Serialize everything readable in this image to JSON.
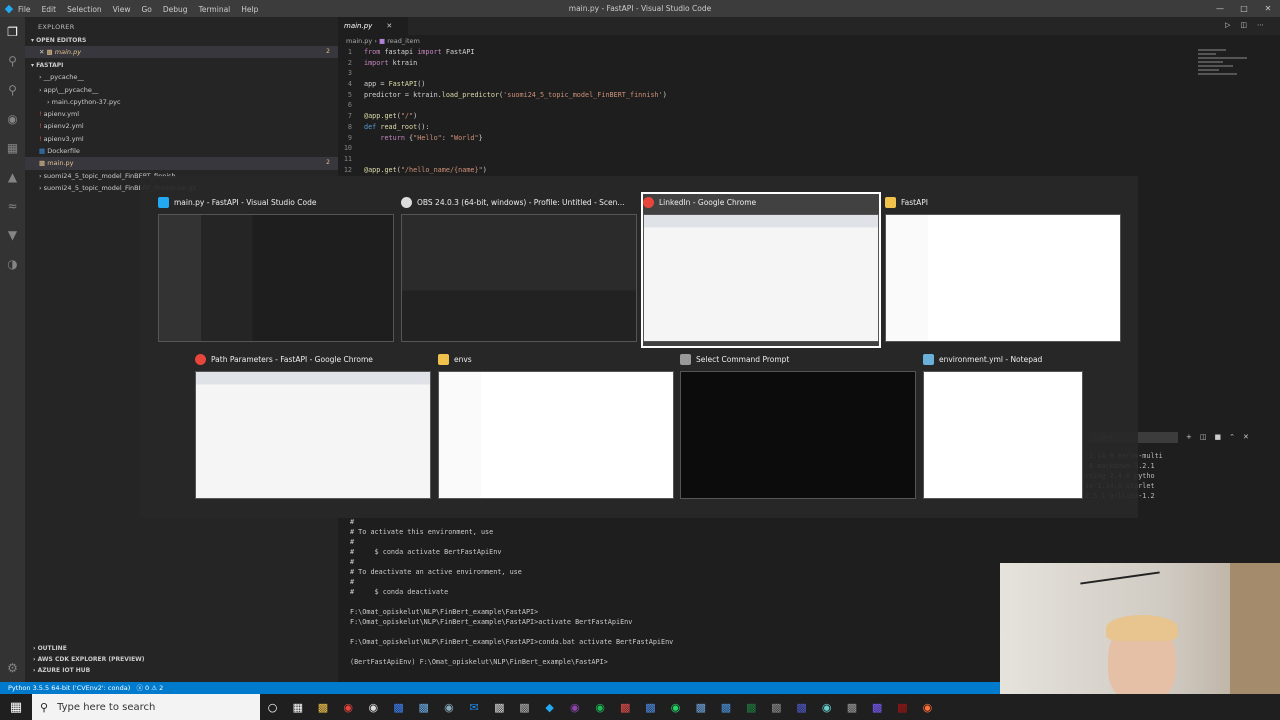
{
  "titlebar": {
    "menu": [
      "File",
      "Edit",
      "Selection",
      "View",
      "Go",
      "Debug",
      "Terminal",
      "Help"
    ],
    "title": "main.py - FastAPI - Visual Studio Code"
  },
  "sidebar": {
    "header": "EXPLORER",
    "open_editors": "OPEN EDITORS",
    "open_editor_file": "main.py",
    "open_editor_badge": "2",
    "folder": "FASTAPI",
    "tree": [
      {
        "label": "__pycache__",
        "indent": 1
      },
      {
        "label": "app\\__pycache__",
        "indent": 1
      },
      {
        "label": "main.cpython-37.pyc",
        "indent": 2
      },
      {
        "label": "apienv.yml",
        "indent": 1,
        "kind": "yml"
      },
      {
        "label": "apienv2.yml",
        "indent": 1,
        "kind": "yml"
      },
      {
        "label": "apienv3.yml",
        "indent": 1,
        "kind": "yml"
      },
      {
        "label": "Dockerfile",
        "indent": 1,
        "kind": "docker"
      },
      {
        "label": "main.py",
        "indent": 1,
        "kind": "py",
        "selected": true,
        "badge": "2"
      },
      {
        "label": "suomi24_5_topic_model_FinBERT_finnish",
        "indent": 1
      },
      {
        "label": "suomi24_5_topic_model_FinBERT_finnish.tar.gz",
        "indent": 1
      }
    ],
    "outline": "OUTLINE",
    "aws": "AWS CDK EXPLORER (PREVIEW)",
    "azure": "AZURE IOT HUB"
  },
  "editor": {
    "tab": "main.py",
    "breadcrumb": [
      "main.py",
      "read_item"
    ],
    "lines": [
      {
        "n": "1",
        "html": "<span class='kw'>from</span> fastapi <span class='kw'>import</span> FastAPI"
      },
      {
        "n": "2",
        "html": "<span class='kw'>import</span> ktrain"
      },
      {
        "n": "3",
        "html": ""
      },
      {
        "n": "4",
        "html": "app = <span class='fn'>FastAPI</span>()"
      },
      {
        "n": "5",
        "html": "predictor = ktrain.<span class='fn'>load_predictor</span>(<span class='str'>'suomi24_5_topic_model_FinBERT_finnish'</span>)"
      },
      {
        "n": "6",
        "html": ""
      },
      {
        "n": "7",
        "html": "<span class='dec'>@app.get</span>(<span class='str'>\"/\"</span>)"
      },
      {
        "n": "8",
        "html": "<span class='df'>def</span> <span class='fn'>read_root</span>():"
      },
      {
        "n": "9",
        "html": "    <span class='kw'>return</span> {<span class='str'>\"Hello\"</span>: <span class='str'>\"World\"</span>}"
      },
      {
        "n": "10",
        "html": ""
      },
      {
        "n": "11",
        "html": ""
      },
      {
        "n": "12",
        "html": "<span class='dec'>@app.get</span>(<span class='str'>\"/hello_name/{name}\"</span>)"
      }
    ]
  },
  "switcher": {
    "row1": [
      {
        "title": "main.py - FastAPI - Visual Studio Code",
        "icon": "vscode-icon",
        "color": "#23a9f2"
      },
      {
        "title": "OBS 24.0.3 (64-bit, windows) - Profile: Untitled - Scen...",
        "icon": "obs-icon",
        "color": "#ddd"
      },
      {
        "title": "LinkedIn - Google Chrome",
        "icon": "chrome-icon",
        "color": "#e8453c",
        "selected": true
      },
      {
        "title": "FastAPI",
        "icon": "folder-icon",
        "color": "#f0c24b"
      }
    ],
    "row2": [
      {
        "title": "Path Parameters - FastAPI - Google Chrome",
        "icon": "chrome-icon",
        "color": "#e8453c"
      },
      {
        "title": "envs",
        "icon": "folder-icon",
        "color": "#f0c24b"
      },
      {
        "title": "Select Command Prompt",
        "icon": "cmd-icon",
        "color": "#999"
      },
      {
        "title": "environment.yml - Notepad",
        "icon": "notepad-icon",
        "color": "#6ab0d8"
      }
    ]
  },
  "terminal": {
    "lines": [
      "#",
      "# To activate this environment, use",
      "#",
      "#     $ conda activate BertFastApiEnv",
      "#",
      "# To deactivate an active environment, use",
      "#",
      "#     $ conda deactivate",
      "",
      "F:\\Omat_opiskelut\\NLP\\FinBert_example\\FastAPI>",
      "F:\\Omat_opiskelut\\NLP\\FinBert_example\\FastAPI>activate BertFastApiEnv",
      "",
      "F:\\Omat_opiskelut\\NLP\\FinBert_example\\FastAPI>conda.bat activate BertFastApiEnv",
      "",
      "(BertFastApiEnv) F:\\Omat_opiskelut\\NLP\\FinBert_example\\FastAPI>"
    ],
    "select_label": "1: cmd",
    "right_lines": [
      "-1.14.0 keras-multi",
      ".8 markdown-3.2.1",
      "rsing-2.4.6 pytho",
      "ix-1.14.0 starlet",
      "2.5.1 urllib3-1.2"
    ]
  },
  "statusbar": {
    "python": "Python 3.5.5 64-bit ('CVEnv2': conda)",
    "problems": "ⓧ 0 ⚠ 2"
  },
  "taskbar": {
    "search_placeholder": "Type here to search"
  }
}
